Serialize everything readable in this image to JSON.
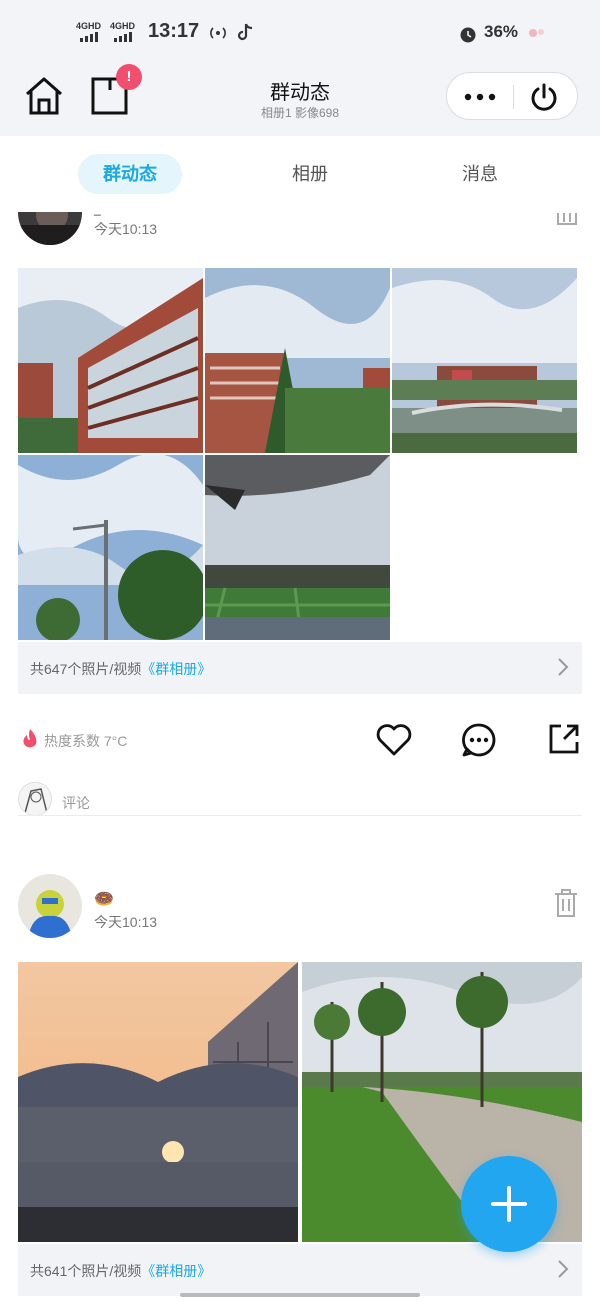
{
  "status_bar": {
    "network1": "4GHD",
    "network2": "4GHD",
    "time": "13:17",
    "battery": "36%",
    "icons": [
      "signal-icon",
      "hotspot-icon",
      "tiktok-icon",
      "alarm-icon",
      "flower-icon"
    ]
  },
  "header": {
    "title": "群动态",
    "subtitle": "相册1 影像698",
    "badge": "!",
    "icons": [
      "home-icon",
      "notification-icon",
      "more-icon",
      "power-icon"
    ]
  },
  "tabs": [
    {
      "label": "群动态",
      "active": true
    },
    {
      "label": "相册",
      "active": false
    },
    {
      "label": "消息",
      "active": false
    }
  ],
  "posts": [
    {
      "name": "_",
      "time": "今天10:13",
      "photos": [
        "campus-building-1",
        "campus-building-2",
        "campus-lake",
        "street-lamp",
        "sports-field"
      ],
      "album_count": "共647个照片/视频",
      "album_link": "《群相册》"
    },
    {
      "name": "🍩",
      "time": "今天10:13",
      "photos": [
        "sunset-building",
        "park-path"
      ],
      "album_count": "共641个照片/视频",
      "album_link": "《群相册》"
    }
  ],
  "actions": {
    "heat": "热度系数 7°C",
    "comment_placeholder": "评论",
    "icons": [
      "fire-icon",
      "like-icon",
      "comment-icon",
      "share-icon"
    ]
  },
  "colors": {
    "accent": "#1ba9e0",
    "fab": "#22a6f0",
    "badge": "#f0506e",
    "heat": "#f0506e"
  }
}
